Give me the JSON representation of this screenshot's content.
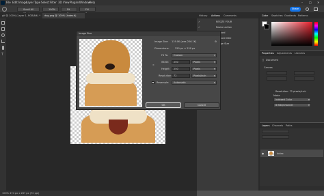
{
  "menubar": {
    "items": [
      "File",
      "Edit",
      "Image",
      "Layer",
      "Type",
      "Select",
      "Filter",
      "3D",
      "View",
      "Plugins",
      "Window",
      "Help"
    ]
  },
  "options_bar": {
    "buttons": [
      "Scroll All Windows",
      "100%",
      "Fit Screen",
      "Fill Screen"
    ],
    "share_label": "Share"
  },
  "document_tabs": [
    {
      "label": "gif @ 100% (Layer 1, RGB/8#) *"
    },
    {
      "label": "dog.png @ 100% (Index#)"
    }
  ],
  "status_bar": {
    "text": "100%   474 px x 287 px (72 ppi)"
  },
  "image_size_dialog": {
    "title": "Image Size",
    "image_size_label": "Image Size:",
    "image_size_value": "119.0K (was 206.1K)",
    "dimensions_label": "Dimensions:",
    "dimensions_value": "250 px × 250 px",
    "fit_to_label": "Fit To:",
    "fit_to_value": "Custom",
    "width_label": "Width:",
    "width_value": "250",
    "width_unit": "Pixels",
    "height_label": "Height:",
    "height_value": "250",
    "height_unit": "Pixels",
    "resolution_label": "Resolution:",
    "resolution_value": "72",
    "resolution_unit": "Pixels/Inch",
    "resample_label": "Resample:",
    "resample_value": "Automatic",
    "ok_label": "OK",
    "cancel_label": "Cancel"
  },
  "history_panel": {
    "tabs": [
      "History",
      "Actions",
      "Comments"
    ],
    "items": [
      "RESIZE YOUR",
      "Resize action",
      "Resized",
      "Resized little",
      "Image Size"
    ]
  },
  "color_panel": {
    "tabs": [
      "Color",
      "Swatches",
      "Gradients",
      "Patterns"
    ]
  },
  "properties_panel": {
    "tabs": [
      "Properties",
      "Adjustments",
      "Libraries"
    ],
    "document_label": "Document",
    "canvas_label": "Canvas",
    "resolution_text": "Resolution: 72 pixels/inch",
    "mode_label": "Mode",
    "mode_value": "Indexed Color",
    "bits_value": "8 Bits/Channel"
  },
  "layers_panel": {
    "tabs": [
      "Layers",
      "Channels",
      "Paths"
    ],
    "layer_name": "Index"
  },
  "colors": {
    "accent": "#1473e6",
    "workspace": "#535353",
    "panel": "#323232",
    "dialog": "#474747"
  }
}
